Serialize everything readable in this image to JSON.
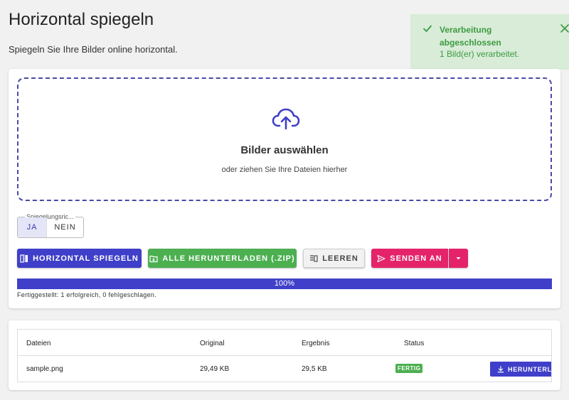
{
  "header": {
    "title": "Horizontal spiegeln",
    "subtitle": "Spiegeln Sie Ihre Bilder online horizontal."
  },
  "toast": {
    "title": "Verarbeitung abgeschlossen",
    "message": "1 Bild(er) verarbeitet.",
    "color": "#3d9a40"
  },
  "dropzone": {
    "title": "Bilder auswählen",
    "subtitle": "oder ziehen Sie Ihre Dateien hierher",
    "icon": "cloud-upload-icon"
  },
  "mirror_toggle": {
    "label": "Spiegelungsric...",
    "options": [
      "JA",
      "NEIN"
    ],
    "selected": "JA"
  },
  "actions": {
    "flip_label": "HORIZONTAL SPIEGELN",
    "download_all_label": "ALLE HERUNTERLADEN (.ZIP)",
    "clear_label": "LEEREN",
    "send_label": "SENDEN AN"
  },
  "progress": {
    "value": 100,
    "label": "100%",
    "status": "Fertiggestellt: 1 erfolgreich, 0 fehlgeschlagen."
  },
  "table": {
    "headers": [
      "Dateien",
      "Original",
      "Ergebnis",
      "Status"
    ],
    "rows": [
      {
        "file": "sample.png",
        "original": "29,49 KB",
        "result": "29,5 KB",
        "status": "FERTIG",
        "action": "HERUNTERLA"
      }
    ]
  },
  "colors": {
    "primary": "#3f3fc9",
    "success": "#4caf50",
    "accent": "#e4236a"
  }
}
